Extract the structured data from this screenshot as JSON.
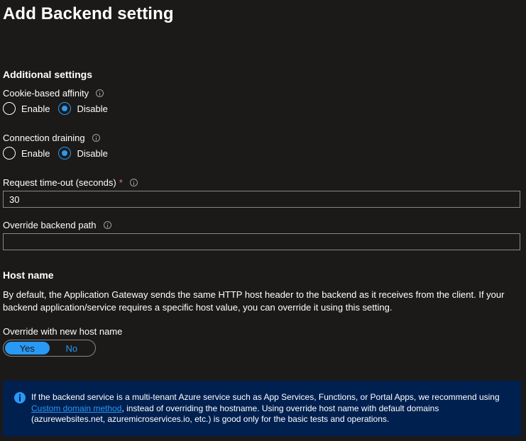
{
  "page": {
    "title": "Add Backend setting"
  },
  "additional_settings": {
    "heading": "Additional settings",
    "cookie_affinity": {
      "label": "Cookie-based affinity",
      "options": [
        "Enable",
        "Disable"
      ],
      "selected": "Disable"
    },
    "connection_draining": {
      "label": "Connection draining",
      "options": [
        "Enable",
        "Disable"
      ],
      "selected": "Disable"
    },
    "request_timeout": {
      "label": "Request time-out (seconds)",
      "required_mark": "*",
      "value": "30"
    },
    "override_path": {
      "label": "Override backend path",
      "value": ""
    }
  },
  "host_name": {
    "heading": "Host name",
    "description": "By default, the Application Gateway sends the same HTTP host header to the backend as it receives from the client. If your backend application/service requires a specific host value, you can override it using this setting.",
    "override_label": "Override with new host name",
    "toggle": {
      "yes": "Yes",
      "no": "No",
      "selected": "Yes"
    }
  },
  "info_box": {
    "text_before_link": "If the backend service is a multi-tenant Azure service such as App Services, Functions, or Portal Apps, we recommend using ",
    "link_text": "Custom domain method",
    "text_after_link": ", instead of overriding the hostname. Using override host name with default domains (azurewebsites.net, azuremicroservices.io, etc.) is good only for the basic tests and operations."
  },
  "colors": {
    "background": "#1b1a19",
    "accent": "#2899f5",
    "info_background": "#002050",
    "required": "#f1707b"
  }
}
